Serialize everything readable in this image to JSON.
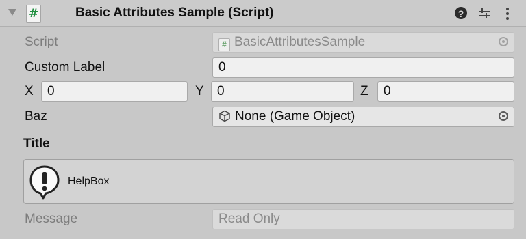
{
  "component": {
    "title": "Basic Attributes Sample (Script)",
    "script_icon_glyph": "#",
    "header_icons": [
      "help-icon",
      "presets-icon",
      "context-menu-icon"
    ],
    "help_glyph": "?"
  },
  "fields": {
    "script": {
      "label": "Script",
      "value": "BasicAttributesSample"
    },
    "custom_label": {
      "label": "Custom Label",
      "value": "0"
    },
    "vector": {
      "x_label": "X",
      "x_value": "0",
      "y_label": "Y",
      "y_value": "0",
      "z_label": "Z",
      "z_value": "0"
    },
    "baz": {
      "label": "Baz",
      "value": "None (Game Object)"
    },
    "title": "Title",
    "helpbox": {
      "text": "HelpBox",
      "icon": "info-icon"
    },
    "message": {
      "label": "Message",
      "value": "Read Only"
    }
  }
}
